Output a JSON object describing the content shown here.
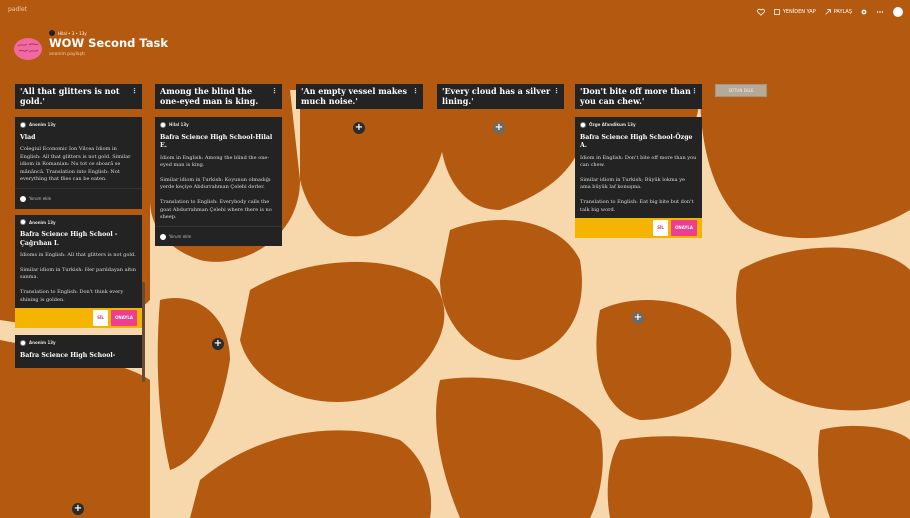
{
  "app": {
    "brand": "padlet"
  },
  "topbar": {
    "remake": "YENİDEN YAP",
    "share": "PAYLAŞ",
    "colors": {
      "bar": "#b45a10"
    }
  },
  "board": {
    "author_meta": "Hilal • 3 • 13y",
    "title": "WOW Second Task",
    "subtitle": "anonim paylaştı"
  },
  "add_column_label": "SÜTUN EKLE",
  "columns": [
    {
      "title": "'All that glitters is not gold.'",
      "cards": [
        {
          "author": "Anonim 13y",
          "title": "Vlad",
          "paragraphs": [
            "Colegiul Economic Ion Vilcea Idiom in English: All that glitters is not gold. Similar idiom in Romanian: Nu tot ce sboară se mănâncă. Translation into English: Not everything that flies can be eaten."
          ],
          "footer": "Yorum ekle"
        },
        {
          "author": "Anonim 13y",
          "title": "Bafra Science High School - Çağrıhan I.",
          "paragraphs": [
            "Idioms in English: All that glitters is not gold.",
            "Similar idiom in Turkish: Her parıldayan altın sanma.",
            "Translation to English: Don't think every shining is golden."
          ],
          "buttons": {
            "delete": "SİL",
            "approve": "ONAYLA"
          }
        },
        {
          "author": "Anonim 13y",
          "title": "Bafra Science High School-"
        }
      ]
    },
    {
      "title": "Among the blind the one-eyed man is king.",
      "cards": [
        {
          "author": "Hilal 13y",
          "title": "Bafra Science High School-Hilal E.",
          "paragraphs": [
            "Idiom in English: Among the blind the one-eyed man is king.",
            "Similar idiom in Turkish: Koyunun olmadığı yerde keçiye Abdurrahman Çelebi derler.",
            "Translation to English: Everybody calls the goat Abdurrahman Çelebi where there is no sheep."
          ],
          "footer": "Yorum ekle"
        }
      ]
    },
    {
      "title": "'An empty vessel makes much noise.'",
      "cards": []
    },
    {
      "title": "'Every cloud has a silver lining.'",
      "cards": []
    },
    {
      "title": "'Don't bite off more than you can chew.'",
      "cards": [
        {
          "author": "Özge Afandikum 13y",
          "title": "Bafra Science High School-Özge A.",
          "paragraphs": [
            "Idiom in English: Don't bite off more than you can chew.",
            "Similar idiom in Turkish; Büyük lokma ye ama büyük laf konuşma.",
            "Translation to English: Eat big bite but don't talk big word."
          ],
          "buttons": {
            "delete": "SİL",
            "approve": "ONAYLA"
          }
        }
      ]
    }
  ],
  "colors": {
    "background_pattern": "#b45a10",
    "background_base": "#f7d8ad",
    "card": "#232323",
    "action_bar": "#f5b400",
    "approve": "#ee3f8e"
  }
}
